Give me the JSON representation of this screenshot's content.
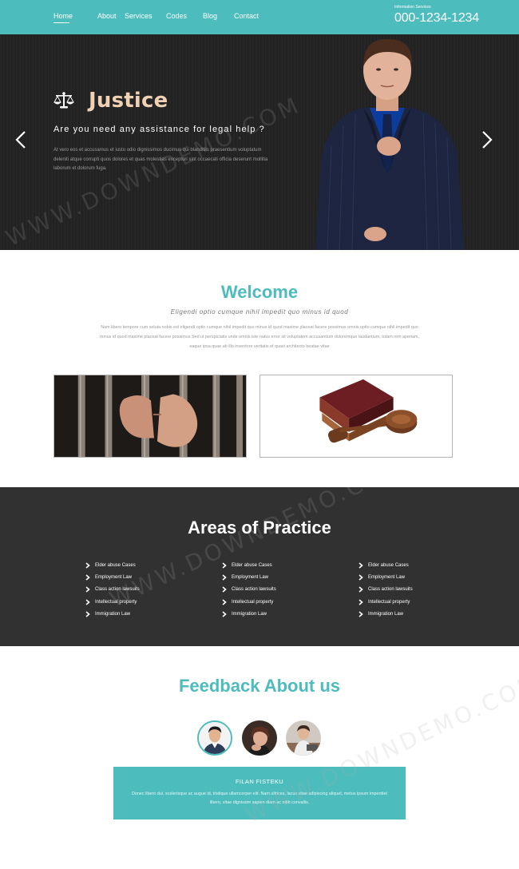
{
  "nav": {
    "items": [
      {
        "label": "Home",
        "active": true
      },
      {
        "label": "About"
      },
      {
        "label": "Services"
      },
      {
        "label": "Codes"
      },
      {
        "label": "Blog"
      },
      {
        "label": "Contact"
      }
    ],
    "info_label": "Information Services",
    "phone": "000-1234-1234"
  },
  "hero": {
    "logo_icon": "scales-of-justice-icon",
    "title": "Justice",
    "subtitle": "Are you need any assistance for legal help ?",
    "text": "At vero eos et accusamus et iusto odio dignissimos ducimus qui blanditiis praesentium voluptatum deleniti atque corrupti quos dolores et quas molestias excepturi sint occaecati officia deserunt mollitia laborum et dolorum fuga.",
    "prev_icon": "chevron-left-icon",
    "next_icon": "chevron-right-icon"
  },
  "welcome": {
    "title": "Welcome",
    "subtitle": "Eligendi optio cumque nihil impedit quo minus id quod",
    "text": "Nam libero tempore cum soluta nobis est eligendi optio cumque nihil impedit quo minus id quod maxime placeat facere possimus omnis opito cumque nihil impedit quo minus id quod maxime placeat facere possimus Sed ut perspiciatis unde omnis iste natus error sit voluptatem accusantium doloremque laudantium, totam rem aperiam, eaque ipsa quae ab illo inventore veritatis et quasi architecto beatae vitae"
  },
  "practice": {
    "title": "Areas of Practice",
    "columns": [
      [
        "Elder abuse Cases",
        "Employment Law",
        "Class action lawsuits",
        "Intellectual property",
        "Immigration Law"
      ],
      [
        "Elder abuse Cases",
        "Employment Law",
        "Class action lawsuits",
        "Intellectual property",
        "Immigration Law"
      ],
      [
        "Elder abuse Cases",
        "Employment Law",
        "Class action lawsuits",
        "Intellectual property",
        "Immigration Law"
      ]
    ]
  },
  "feedback": {
    "title": "Feedback About us",
    "name": "FILAN FISTEKU",
    "text": "Donec libero dui, scelerisque ac augue id, tristique ullamcorper elit. Nam ultrices, lacus vitae adipiscing aliquet, metus ipsum imperdiet libero, vitae dignissim sapien diam ac nibh convallis."
  },
  "watermark": "WWW.DOWNDEMO.COM",
  "colors": {
    "accent": "#4dbcbc",
    "hero_title": "#f1d1b4",
    "dark": "#313131"
  }
}
